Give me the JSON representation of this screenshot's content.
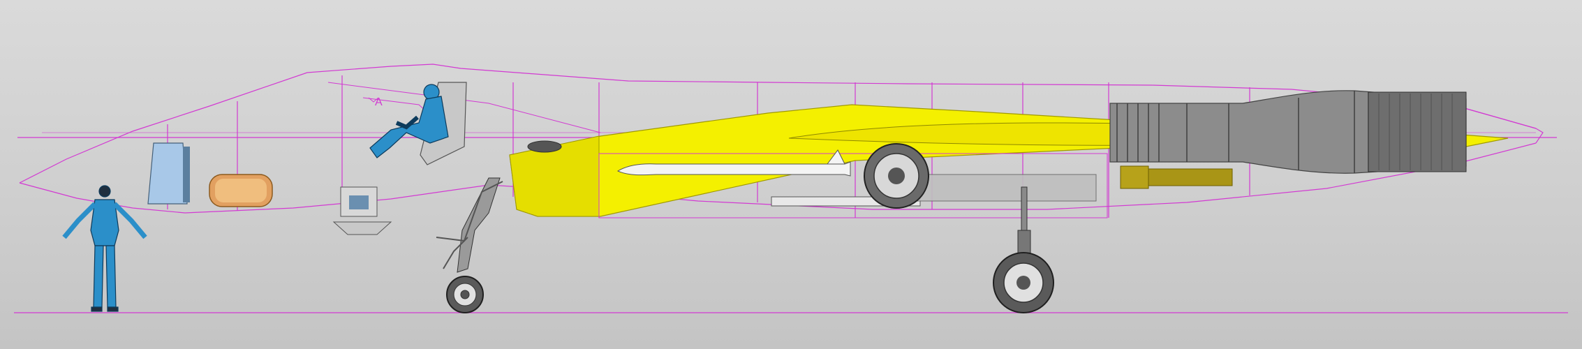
{
  "viewport": {
    "title": ""
  },
  "annotations": {
    "station_marker": "A"
  },
  "colors": {
    "background_top": "#dadada",
    "background_bottom": "#c4c4c4",
    "construction_lines": "#d23ad2",
    "weapons_bay_fill": "#f4f000",
    "engine_gray": "#8c8c8c",
    "mannequin_blue": "#2b8fc9",
    "missile_white": "#f4f4f4",
    "fuel_pump_gold": "#b7a21a"
  },
  "icons": {
    "reference_pilot": "standing-person-icon",
    "seated_pilot": "seated-pilot-icon",
    "engine": "turbofan-engine-icon",
    "nose_wheel": "nose-wheel-icon",
    "main_wheel": "main-wheel-icon"
  }
}
